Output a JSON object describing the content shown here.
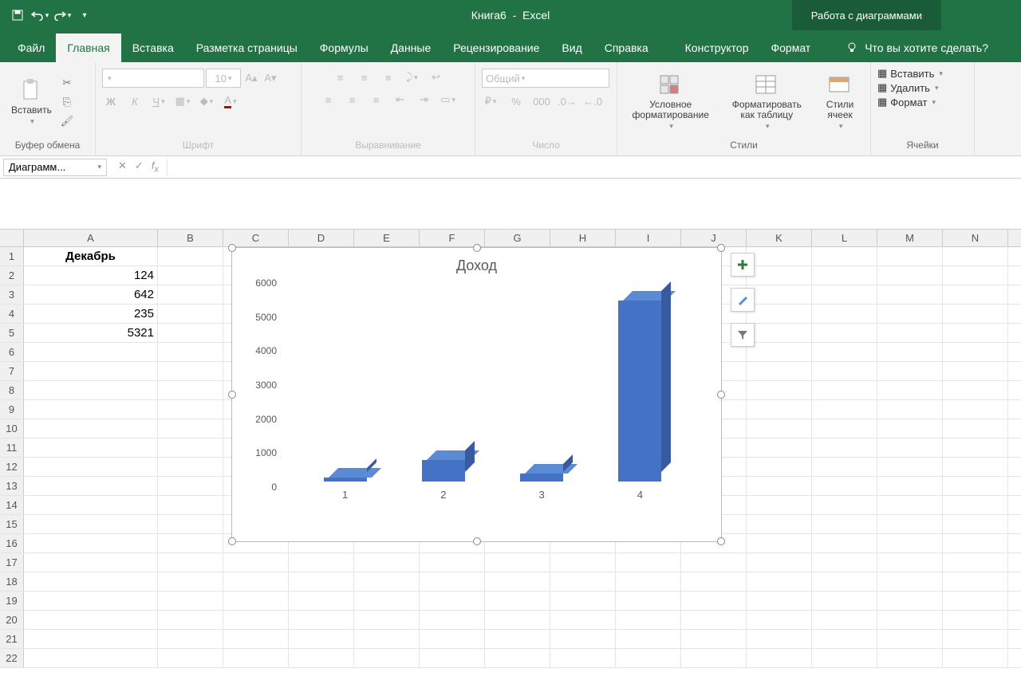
{
  "title": {
    "doc": "Книга6",
    "app": "Excel",
    "context": "Работа с диаграммами"
  },
  "tabs": {
    "file": "Файл",
    "home": "Главная",
    "insert": "Вставка",
    "layout": "Разметка страницы",
    "formulas": "Формулы",
    "data": "Данные",
    "review": "Рецензирование",
    "view": "Вид",
    "help": "Справка",
    "design": "Конструктор",
    "format": "Формат",
    "tellme": "Что вы хотите сделать?"
  },
  "ribbon": {
    "clipboard": {
      "label": "Буфер обмена",
      "paste": "Вставить"
    },
    "font": {
      "label": "Шрифт",
      "name": "",
      "size": "10"
    },
    "alignment": {
      "label": "Выравнивание"
    },
    "number": {
      "label": "Число",
      "format": "Общий"
    },
    "styles": {
      "label": "Стили",
      "cond": "Условное форматирование",
      "table": "Форматировать как таблицу",
      "cell": "Стили ячеек"
    },
    "cells": {
      "label": "Ячейки",
      "insert": "Вставить",
      "delete": "Удалить",
      "format": "Формат"
    }
  },
  "formula_bar": {
    "name": "Диаграмм..."
  },
  "sheet": {
    "columns": [
      "A",
      "B",
      "C",
      "D",
      "E",
      "F",
      "G",
      "H",
      "I",
      "J",
      "K",
      "L",
      "M",
      "N"
    ],
    "rows_shown": 22,
    "a_header": "Декабрь",
    "a_values": {
      "2": "124",
      "3": "642",
      "4": "235",
      "5": "5321"
    }
  },
  "chart_data": {
    "type": "bar",
    "title": "Доход",
    "categories": [
      "1",
      "2",
      "3",
      "4"
    ],
    "values": [
      124,
      642,
      235,
      5321
    ],
    "ylim": [
      0,
      6000
    ],
    "yticks": [
      0,
      1000,
      2000,
      3000,
      4000,
      5000,
      6000
    ],
    "xlabel": "",
    "ylabel": ""
  }
}
